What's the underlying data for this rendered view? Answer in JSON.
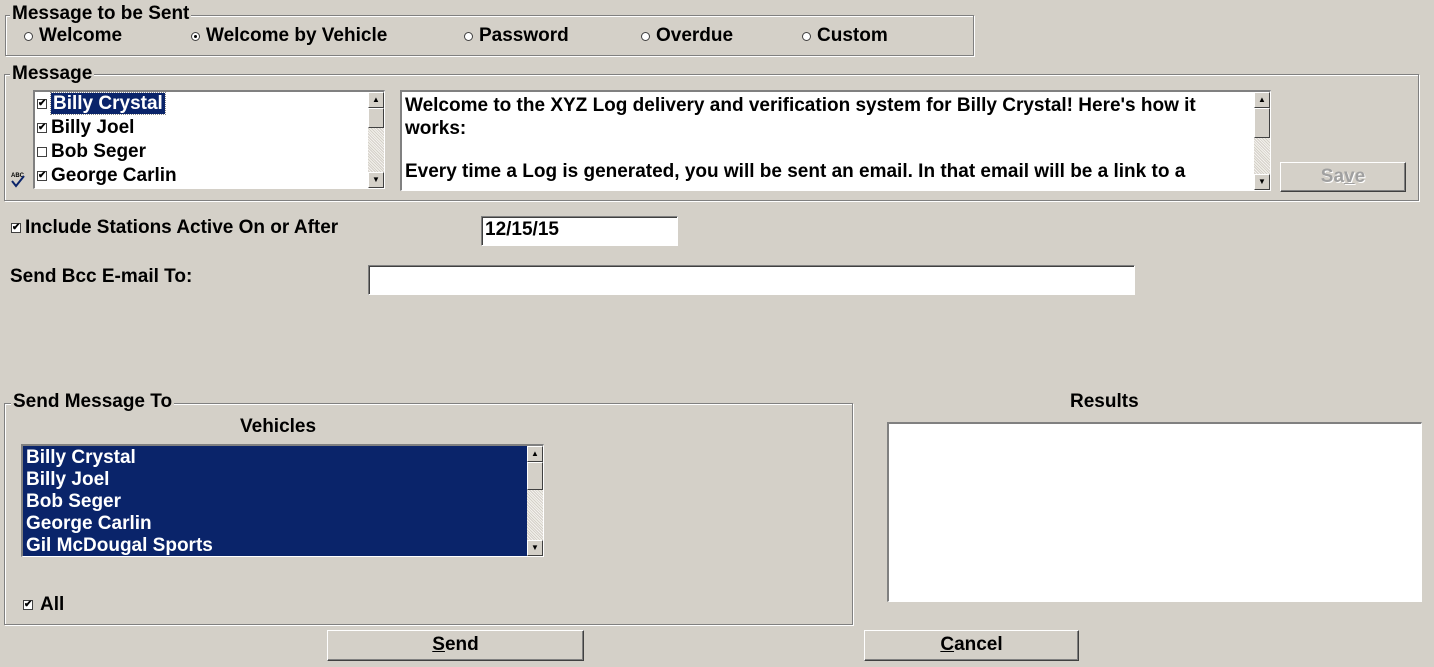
{
  "message_to_be_sent": {
    "legend": "Message to be Sent",
    "options": [
      {
        "label": "Welcome",
        "selected": false
      },
      {
        "label": "Welcome by Vehicle",
        "selected": true
      },
      {
        "label": "Password",
        "selected": false
      },
      {
        "label": "Overdue",
        "selected": false
      },
      {
        "label": "Custom",
        "selected": false
      }
    ]
  },
  "message": {
    "legend": "Message",
    "recipients": [
      {
        "name": "Billy Crystal",
        "checked": true,
        "selected": true
      },
      {
        "name": "Billy Joel",
        "checked": true,
        "selected": false
      },
      {
        "name": "Bob Seger",
        "checked": false,
        "selected": false
      },
      {
        "name": "George Carlin",
        "checked": true,
        "selected": false
      }
    ],
    "body_line1": "Welcome to the XYZ Log delivery and verification system for Billy Crystal!  Here's how it",
    "body_line2": "works:",
    "body_line3": "Every time a Log is generated, you will be sent an email.  In that email will be a link to a",
    "save_label": "Save",
    "save_underline": "v"
  },
  "include_stations": {
    "label": "Include Stations Active On or After",
    "checked": true,
    "date": "12/15/15"
  },
  "bcc": {
    "label": "Send Bcc E-mail To:",
    "value": ""
  },
  "send_message_to": {
    "legend": "Send Message To",
    "vehicles_header": "Vehicles",
    "vehicles": [
      "Billy Crystal",
      "Billy Joel",
      "Bob Seger",
      "George Carlin",
      "Gil McDougal Sports"
    ],
    "all_label": "All",
    "all_checked": true
  },
  "results": {
    "label": "Results",
    "content": ""
  },
  "buttons": {
    "send_first": "S",
    "send_rest": "end",
    "cancel_first": "C",
    "cancel_rest": "ancel"
  },
  "icons": {
    "spellcheck": "spellcheck-icon",
    "selection_color": "#0a246a",
    "face_color": "#d4d0c8"
  }
}
